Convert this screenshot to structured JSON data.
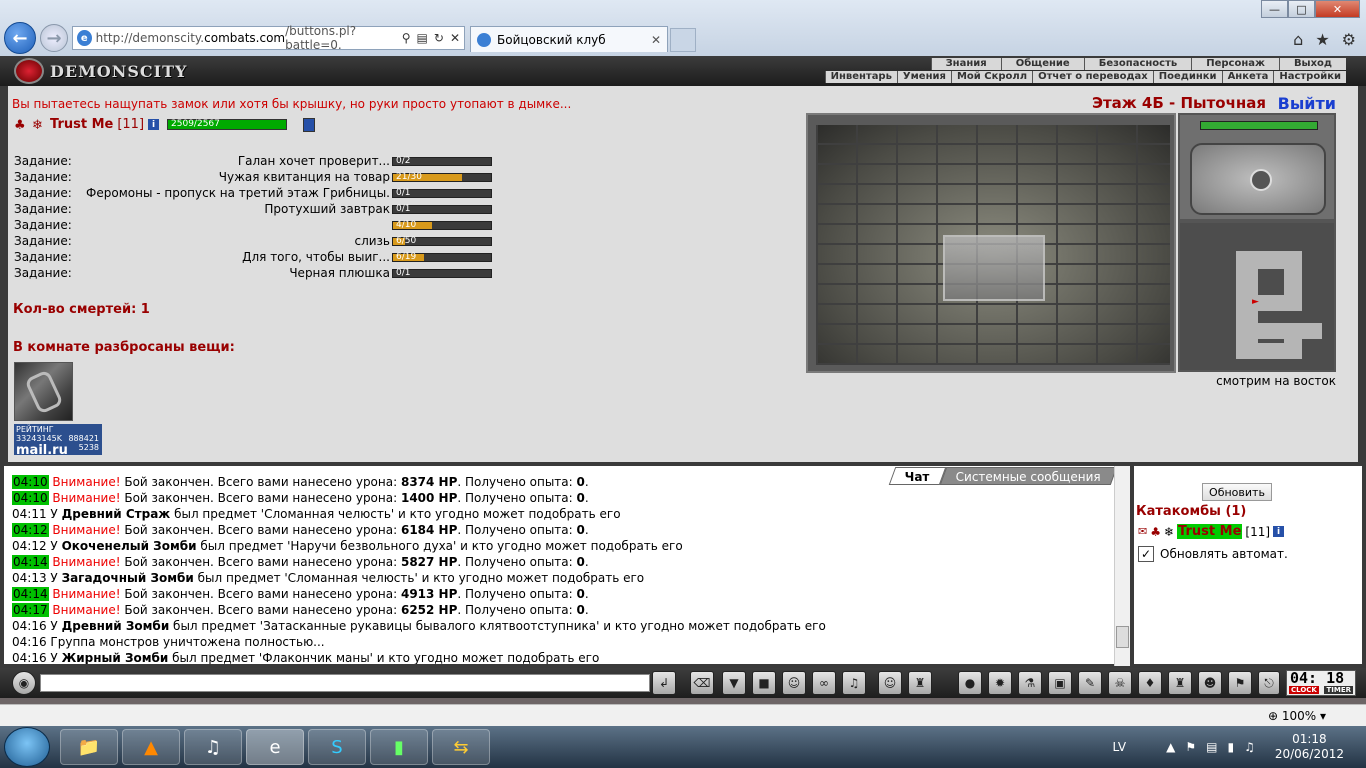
{
  "browser": {
    "url_prefix": "http://demonscity.",
    "url_domain": "combats.com",
    "url_rest": "/buttons.pl?battle=0.",
    "tab_title": "Бойцовский клуб"
  },
  "header": {
    "logo": "DEMONSCITY",
    "menu_top": [
      "Знания",
      "Общение",
      "Безопасность",
      "Персонаж",
      "Выход"
    ],
    "menu_bottom": [
      "Инвентарь",
      "Умения",
      "Мой Скролл",
      "Отчет о переводах",
      "Поединки",
      "Анкета",
      "Настройки"
    ]
  },
  "game": {
    "message": "Вы пытаетесь нащупать замок или хотя бы крышку, но руки просто утопают в дымке...",
    "char_name": "Trust Me",
    "char_level": "[11]",
    "hp": "2509/2567",
    "info_icon": "i",
    "location": "Этаж 4Б - Пыточная",
    "exit": "Выйти",
    "facing": "смотрим на восток",
    "deaths": "Кол-во смертей: 1",
    "items_title": "В комнате разбросаны вещи:",
    "tasks": [
      {
        "label": "Задание:",
        "desc": "Галан хочет проверит...",
        "progress": "0/2",
        "fraction": 0
      },
      {
        "label": "Задание:",
        "desc": "Чужая квитанция на товар",
        "progress": "21/30",
        "fraction": 0.7
      },
      {
        "label": "Задание:",
        "desc": "Феромоны - пропуск на третий этаж Грибницы.",
        "progress": "0/1",
        "fraction": 0
      },
      {
        "label": "Задание:",
        "desc": "Протухший завтрак",
        "progress": "0/1",
        "fraction": 0
      },
      {
        "label": "Задание:",
        "desc": "",
        "progress": "4/10",
        "fraction": 0.4
      },
      {
        "label": "Задание:",
        "desc": "слизь",
        "progress": "6/50",
        "fraction": 0.12
      },
      {
        "label": "Задание:",
        "desc": "Для того, чтобы выиг...",
        "progress": "6/19",
        "fraction": 0.32
      },
      {
        "label": "Задание:",
        "desc": "Черная плюшка",
        "progress": "0/1",
        "fraction": 0
      }
    ],
    "counter": {
      "label": "РЕЙТИНГ",
      "id": "33243145K",
      "brand": "mail.ru",
      "n1": "888421",
      "n2": "5238"
    }
  },
  "chat": {
    "tabs": [
      "Чат",
      "Системные сообщения"
    ],
    "lines": [
      {
        "ts": "04:10",
        "green": true,
        "warn": "Внимание!",
        "text": " Бой закончен. Всего вами нанесено урона: ",
        "bold": "1400 HP",
        "tail": ". Получено опыта: ",
        "bold2": "0",
        "end": "."
      },
      {
        "ts": "04:11",
        "green": false,
        "pre": "У ",
        "bold": "Древний Страж",
        "text": " был предмет 'Сломанная челюсть' и кто угодно может подобрать его"
      },
      {
        "ts": "04:12",
        "green": true,
        "warn": "Внимание!",
        "text": " Бой закончен. Всего вами нанесено урона: ",
        "bold": "6184 HP",
        "tail": ". Получено опыта: ",
        "bold2": "0",
        "end": "."
      },
      {
        "ts": "04:12",
        "green": false,
        "pre": "У ",
        "bold": "Окоченелый Зомби",
        "text": " был предмет 'Наручи безвольного духа' и кто угодно может подобрать его"
      },
      {
        "ts": "04:14",
        "green": true,
        "warn": "Внимание!",
        "text": " Бой закончен. Всего вами нанесено урона: ",
        "bold": "5827 HP",
        "tail": ". Получено опыта: ",
        "bold2": "0",
        "end": "."
      },
      {
        "ts": "04:13",
        "green": false,
        "pre": "У ",
        "bold": "Загадочный Зомби",
        "text": " был предмет 'Сломанная челюсть' и кто угодно может подобрать его"
      },
      {
        "ts": "04:14",
        "green": true,
        "warn": "Внимание!",
        "text": " Бой закончен. Всего вами нанесено урона: ",
        "bold": "4913 HP",
        "tail": ". Получено опыта: ",
        "bold2": "0",
        "end": "."
      },
      {
        "ts": "04:17",
        "green": true,
        "warn": "Внимание!",
        "text": " Бой закончен. Всего вами нанесено урона: ",
        "bold": "6252 HP",
        "tail": ". Получено опыта: ",
        "bold2": "0",
        "end": "."
      },
      {
        "ts": "04:16",
        "green": false,
        "pre": "У ",
        "bold": "Древний Зомби",
        "text": " был предмет 'Затасканные рукавицы бывалого клятвоотступника' и кто угодно может подобрать его"
      },
      {
        "ts": "04:16",
        "green": false,
        "pre": "Группа монстров уничтожена полностью...",
        "bold": "",
        "text": ""
      },
      {
        "ts": "04:16",
        "green": false,
        "pre": "У ",
        "bold": "Жирный Зомби",
        "text": " был предмет 'Флакончик маны' и кто угодно может подобрать его"
      }
    ],
    "top_line": {
      "ts": "04:10",
      "green": true,
      "warn": "Внимание!",
      "text": " Бой закончен. Всего вами нанесено урона: ",
      "bold": "8374 HP",
      "tail": ". Получено опыта: ",
      "bold2": "0",
      "end": "."
    }
  },
  "room": {
    "refresh": "Обновить",
    "title": "Катакомбы (1)",
    "char": "Trust Me",
    "level": "[11]",
    "auto": "Обновлять автомат.",
    "auto_mark": "✓"
  },
  "clock": {
    "time": "04: 18",
    "clock_label": "CLOCK",
    "timer_label": "TIMER"
  },
  "status": {
    "zoom": "100%"
  },
  "taskbar": {
    "lang": "LV",
    "time": "01:18",
    "date": "20/06/2012"
  }
}
